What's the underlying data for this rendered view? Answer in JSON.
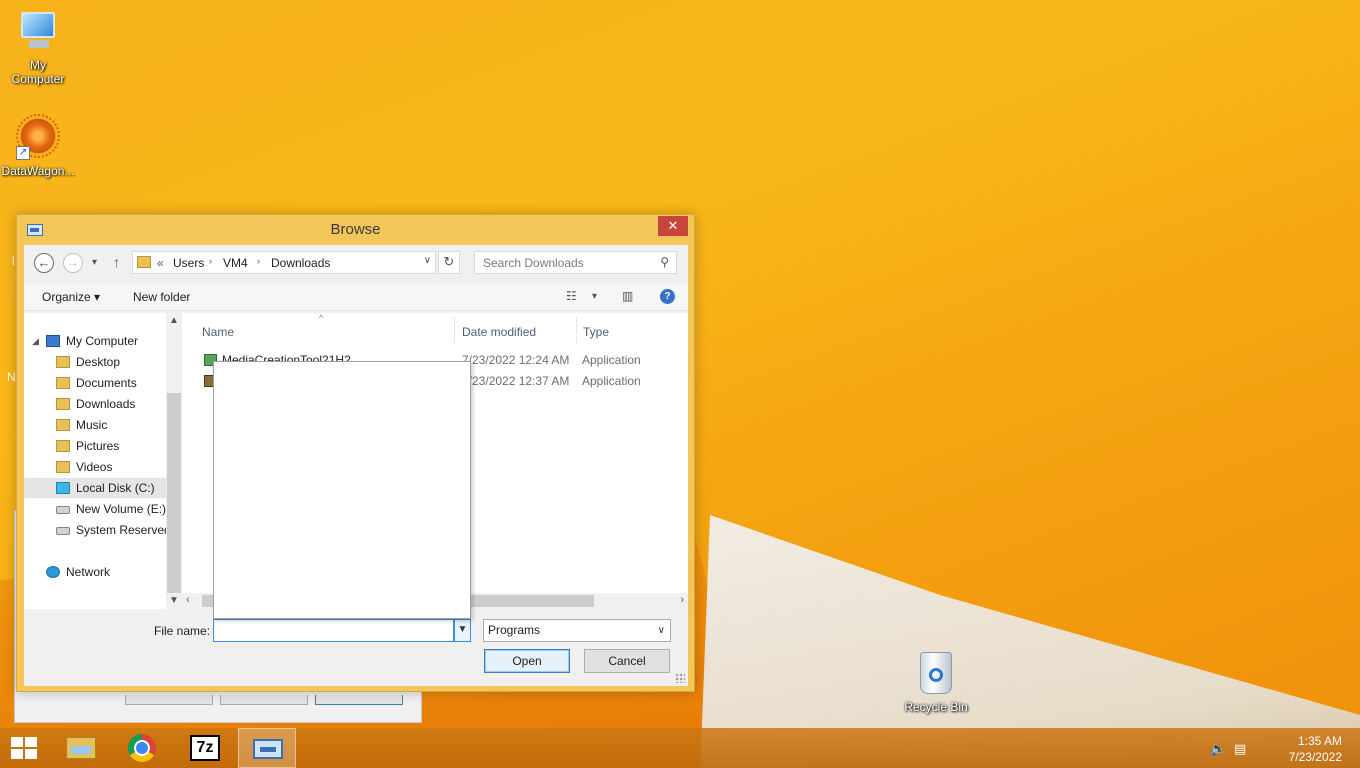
{
  "desktop": {
    "icons": [
      {
        "label": "My\nComputer",
        "icon": "my-computer-icon"
      },
      {
        "label": "DataWagon...",
        "icon": "datawagon-icon"
      },
      {
        "label": "Recycle Bin",
        "icon": "recycle-bin-icon"
      }
    ],
    "stray_labels": [
      "l",
      "N"
    ]
  },
  "dialog": {
    "title": "Browse",
    "close_glyph": "✕",
    "nav": {
      "back": "←",
      "forward": "→",
      "recent": "▾",
      "up": "↑"
    },
    "address": {
      "overflow": "«",
      "crumbs": [
        "Users",
        "VM4",
        "Downloads"
      ],
      "separator": "›",
      "dropdown": "∨",
      "refresh": "↻"
    },
    "search": {
      "placeholder": "Search Downloads",
      "value": ""
    },
    "commands": {
      "organize": "Organize ▾",
      "new_folder": "New folder",
      "view_dd": "▾"
    },
    "nav_pane": {
      "items": [
        {
          "label": "My Computer",
          "icon": "computer-icon"
        },
        {
          "label": "Desktop",
          "icon": "folder-icon"
        },
        {
          "label": "Documents",
          "icon": "folder-icon"
        },
        {
          "label": "Downloads",
          "icon": "folder-icon"
        },
        {
          "label": "Music",
          "icon": "folder-icon"
        },
        {
          "label": "Pictures",
          "icon": "folder-icon"
        },
        {
          "label": "Videos",
          "icon": "folder-icon"
        },
        {
          "label": "Local Disk (C:)",
          "icon": "windows-disk-icon",
          "selected": true
        },
        {
          "label": "New Volume (E:)",
          "icon": "drive-icon"
        },
        {
          "label": "System Reserved",
          "icon": "drive-icon"
        },
        {
          "label": "Network",
          "icon": "network-icon"
        }
      ]
    },
    "file_list": {
      "columns": [
        "Name",
        "Date modified",
        "Type"
      ],
      "rows": [
        {
          "name": "MediaCreationTool21H2",
          "date": "7/23/2022 12:24 AM",
          "type": "Application"
        },
        {
          "name": "",
          "date": "7/23/2022 12:37 AM",
          "type": "Application"
        }
      ]
    },
    "file_name": {
      "label": "File name:",
      "value": ""
    },
    "file_type": {
      "value": "Programs"
    },
    "buttons": {
      "open": "Open",
      "cancel": "Cancel"
    }
  },
  "taskbar": {
    "apps": [
      {
        "name": "start",
        "icon": "windows-logo-icon"
      },
      {
        "name": "file-explorer",
        "icon": "folder-icon"
      },
      {
        "name": "chrome",
        "icon": "chrome-icon"
      },
      {
        "name": "7-zip",
        "icon": "7zip-icon",
        "text": "7z"
      },
      {
        "name": "browse-app",
        "icon": "window-icon",
        "active": true
      }
    ],
    "clock": {
      "time": "1:35 AM",
      "date": "7/23/2022"
    }
  }
}
